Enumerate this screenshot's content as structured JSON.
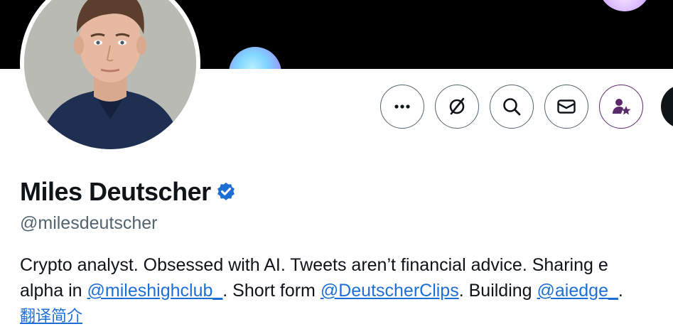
{
  "profile": {
    "display_name": "Miles Deutscher",
    "handle": "@milesdeutscher",
    "verified_icon": "verified-badge-icon",
    "bio": {
      "line1": "Crypto analyst. Obsessed with AI. Tweets aren’t financial advice. Sharing e",
      "line2_prefix": "alpha in ",
      "mention1": "@mileshighclub_",
      "line2_mid": ". Short form ",
      "mention2": "@DeutscherClips",
      "line2_mid2": ". Building ",
      "mention3": "@aiedge_",
      "line2_suffix": "."
    },
    "translate_label": "翻译简介"
  },
  "actions": {
    "more_icon": "more-icon",
    "grok_icon": "grok-icon",
    "search_icon": "search-icon",
    "message_icon": "envelope-icon",
    "subscribe_icon": "subscribe-icon"
  },
  "colors": {
    "text_primary": "#0f1419",
    "text_secondary": "#536471",
    "link": "#1d6fd6",
    "verified": "#1d9bf0",
    "banner": "#000000",
    "subscribe_accent": "#5a2a6b"
  }
}
